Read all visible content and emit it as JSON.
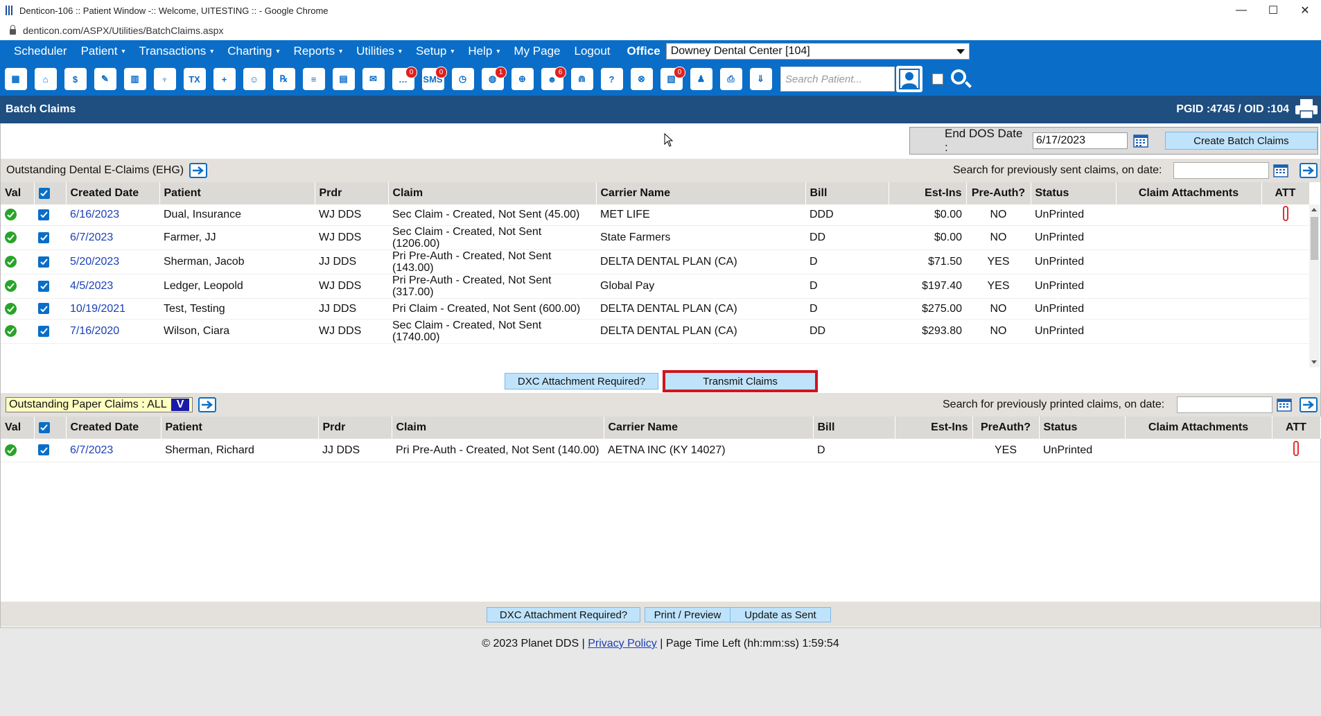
{
  "browser": {
    "window_title": "Denticon-106 :: Patient Window -:: Welcome, UITESTING :: - Google Chrome",
    "url": "denticon.com/ASPX/Utilities/BatchClaims.aspx",
    "controls": {
      "minimize": "—",
      "maximize": "☐",
      "close": "✕"
    }
  },
  "menu": {
    "items": [
      {
        "label": "Scheduler",
        "caret": false
      },
      {
        "label": "Patient",
        "caret": true
      },
      {
        "label": "Transactions",
        "caret": true
      },
      {
        "label": "Charting",
        "caret": true
      },
      {
        "label": "Reports",
        "caret": true
      },
      {
        "label": "Utilities",
        "caret": true
      },
      {
        "label": "Setup",
        "caret": true
      },
      {
        "label": "Help",
        "caret": true
      },
      {
        "label": "My Page",
        "caret": false
      },
      {
        "label": "Logout",
        "caret": false
      }
    ],
    "caret_glyph": "▾",
    "office_label": "Office",
    "office_value": "Downey Dental Center [104]"
  },
  "toolbar": {
    "icons": [
      {
        "name": "calendar-icon",
        "glyph": "▦",
        "badge": ""
      },
      {
        "name": "home-icon",
        "glyph": "⌂",
        "badge": ""
      },
      {
        "name": "dollar-icon",
        "glyph": "$",
        "badge": ""
      },
      {
        "name": "pencil-icon",
        "glyph": "✎",
        "badge": ""
      },
      {
        "name": "tooth-chart-icon",
        "glyph": "▥",
        "badge": ""
      },
      {
        "name": "tooth-icon",
        "glyph": "♆",
        "badge": ""
      },
      {
        "name": "tx-icon",
        "glyph": "TX",
        "badge": ""
      },
      {
        "name": "add-patient-icon",
        "glyph": "+",
        "badge": ""
      },
      {
        "name": "family-icon",
        "glyph": "☺",
        "badge": ""
      },
      {
        "name": "rx-icon",
        "glyph": "℞",
        "badge": ""
      },
      {
        "name": "notes-icon",
        "glyph": "≡",
        "badge": ""
      },
      {
        "name": "document-icon",
        "glyph": "▤",
        "badge": ""
      },
      {
        "name": "mail-icon",
        "glyph": "✉",
        "badge": ""
      },
      {
        "name": "message-icon",
        "glyph": "…",
        "badge": "0"
      },
      {
        "name": "sms-icon",
        "glyph": "SMS",
        "badge": "0"
      },
      {
        "name": "clock-icon",
        "glyph": "◷",
        "badge": ""
      },
      {
        "name": "globe-alert-icon",
        "glyph": "◍",
        "badge": "1"
      },
      {
        "name": "globe-icon",
        "glyph": "⊕",
        "badge": ""
      },
      {
        "name": "reminder-icon",
        "glyph": "☻",
        "badge": "6"
      },
      {
        "name": "perio-icon",
        "glyph": "⋒",
        "badge": ""
      },
      {
        "name": "help-tooth-icon",
        "glyph": "?",
        "badge": ""
      },
      {
        "name": "web-icon",
        "glyph": "⊗",
        "badge": ""
      },
      {
        "name": "claims-icon",
        "glyph": "▧",
        "badge": "0"
      },
      {
        "name": "group-icon",
        "glyph": "♟",
        "badge": ""
      },
      {
        "name": "print-icon",
        "glyph": "⎙",
        "badge": ""
      },
      {
        "name": "download-icon",
        "glyph": "⇓",
        "badge": ""
      }
    ],
    "search_placeholder": "Search Patient..."
  },
  "page": {
    "title": "Batch Claims",
    "pgid_text": "PGID :4745  /  OID :104",
    "end_dos_label": "End DOS Date :",
    "end_dos_value": "6/17/2023",
    "create_batch_label": "Create Batch Claims"
  },
  "eclaims": {
    "title": "Outstanding Dental E-Claims (EHG)",
    "search_label": "Search for previously sent claims, on date:",
    "columns": [
      "Val",
      "",
      "Created Date",
      "Patient",
      "Prdr",
      "Claim",
      "Carrier Name",
      "Bill",
      "Est-Ins",
      "Pre-Auth?",
      "Status",
      "Claim Attachments",
      "ATT"
    ],
    "rows": [
      {
        "date": "6/16/2023",
        "patient": "Dual, Insurance",
        "prdr": "WJ DDS",
        "claim": "Sec Claim - Created, Not Sent (45.00)",
        "carrier": "MET LIFE",
        "bill": "DDD",
        "est": "$0.00",
        "preauth": "NO",
        "status": "UnPrinted",
        "att": true
      },
      {
        "date": "6/7/2023",
        "patient": "Farmer, JJ",
        "prdr": "WJ DDS",
        "claim": "Sec Claim - Created, Not Sent (1206.00)",
        "carrier": "State Farmers",
        "bill": "DD",
        "est": "$0.00",
        "preauth": "NO",
        "status": "UnPrinted",
        "att": false
      },
      {
        "date": "5/20/2023",
        "patient": "Sherman, Jacob",
        "prdr": "JJ DDS",
        "claim": "Pri Pre-Auth - Created, Not Sent (143.00)",
        "carrier": "DELTA DENTAL PLAN (CA)",
        "bill": "D",
        "est": "$71.50",
        "preauth": "YES",
        "status": "UnPrinted",
        "att": false
      },
      {
        "date": "4/5/2023",
        "patient": "Ledger, Leopold",
        "prdr": "WJ DDS",
        "claim": "Pri Pre-Auth - Created, Not Sent (317.00)",
        "carrier": "Global Pay",
        "bill": "D",
        "est": "$197.40",
        "preauth": "YES",
        "status": "UnPrinted",
        "att": false
      },
      {
        "date": "10/19/2021",
        "patient": "Test, Testing",
        "prdr": "JJ DDS",
        "claim": "Pri Claim - Created, Not Sent (600.00)",
        "carrier": "DELTA DENTAL PLAN (CA)",
        "bill": "D",
        "est": "$275.00",
        "preauth": "NO",
        "status": "UnPrinted",
        "att": false
      },
      {
        "date": "7/16/2020",
        "patient": "Wilson, Ciara",
        "prdr": "WJ DDS",
        "claim": "Sec Claim - Created, Not Sent (1740.00)",
        "carrier": "DELTA DENTAL PLAN (CA)",
        "bill": "DD",
        "est": "$293.80",
        "preauth": "NO",
        "status": "UnPrinted",
        "att": false
      }
    ],
    "dxc_label": "DXC Attachment Required?",
    "transmit_label": "Transmit Claims"
  },
  "paper": {
    "title": "Outstanding Paper Claims : ALL",
    "filter_value": "V",
    "search_label": "Search for previously printed claims, on date:",
    "columns": [
      "Val",
      "",
      "Created Date",
      "Patient",
      "Prdr",
      "Claim",
      "Carrier Name",
      "Bill",
      "Est-Ins",
      "PreAuth?",
      "Status",
      "Claim Attachments",
      "ATT"
    ],
    "rows": [
      {
        "date": "6/7/2023",
        "patient": "Sherman, Richard",
        "prdr": "JJ DDS",
        "claim": "Pri Pre-Auth - Created, Not Sent (140.00)",
        "carrier": "AETNA INC (KY 14027)",
        "bill": "D",
        "est": "",
        "preauth": "YES",
        "status": "UnPrinted",
        "att": true
      }
    ],
    "dxc_label": "DXC Attachment Required?",
    "print_label": "Print / Preview",
    "update_label": "Update as Sent"
  },
  "footer": {
    "copyright": "© 2023 Planet DDS | ",
    "privacy": "Privacy Policy",
    "time_text": " |  Page Time Left (hh:mm:ss) 1:59:54"
  },
  "colors": {
    "menu_blue": "#0a6ec8",
    "header_navy": "#1f4e80",
    "link_blue": "#1a3fb8",
    "highlight_red": "#d0141e"
  }
}
